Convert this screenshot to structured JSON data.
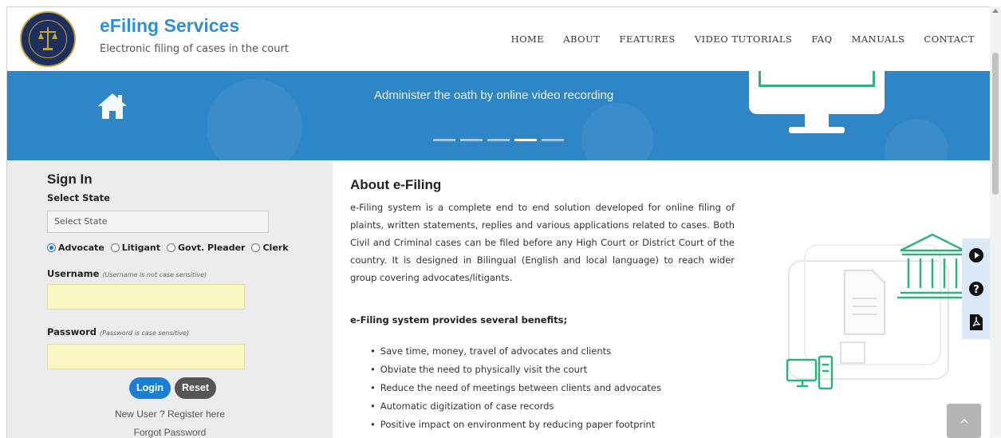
{
  "header": {
    "title": "eFiling Services",
    "subtitle": "Electronic filing of cases in the court",
    "nav": [
      "HOME",
      "ABOUT",
      "FEATURES",
      "VIDEO TUTORIALS",
      "FAQ",
      "MANUALS",
      "CONTACT"
    ]
  },
  "banner": {
    "caption": "Administer the oath by online video recording",
    "slides_total": 5,
    "active_slide": 4
  },
  "signin": {
    "title": "Sign In",
    "select_state_label": "Select State",
    "select_state_value": "Select State",
    "roles": [
      "Advocate",
      "Litigant",
      "Govt. Pleader",
      "Clerk"
    ],
    "selected_role": "Advocate",
    "username_label": "Username",
    "username_hint": "(Username is not case sensitive)",
    "password_label": "Password",
    "password_hint": "(Password is case sensitive)",
    "login_label": "Login",
    "reset_label": "Reset",
    "register_link": "New User ? Register here",
    "forgot_link": "Forgot Password"
  },
  "about": {
    "title": "About e-Filing",
    "paragraph": "e-Filing system is a complete end to end solution developed for online filing of plaints, written statements, replies and various applications related to cases. Both Civil and Criminal cases can be filed before any High Court or District Court of the country. It is designed in Bilingual (English and local language) to reach wider group covering advocates/litigants.",
    "benefits_title": "e-Filing system provides several benefits;",
    "benefits": [
      "Save time, money, travel of advocates and clients",
      "Obviate the need to physically visit the court",
      "Reduce the need of meetings between clients and advocates",
      "Automatic digitization of case records",
      "Positive impact on environment by reducing paper footprint"
    ]
  },
  "side_icons": [
    "play-icon",
    "help-icon",
    "pdf-icon"
  ],
  "colors": {
    "brand_blue": "#2f8fd6",
    "banner_blue": "#2f86c6",
    "illustration_green": "#2db37a",
    "login_button": "#1a7fd4",
    "reset_button": "#555555",
    "input_bg": "#fbf7c2"
  }
}
